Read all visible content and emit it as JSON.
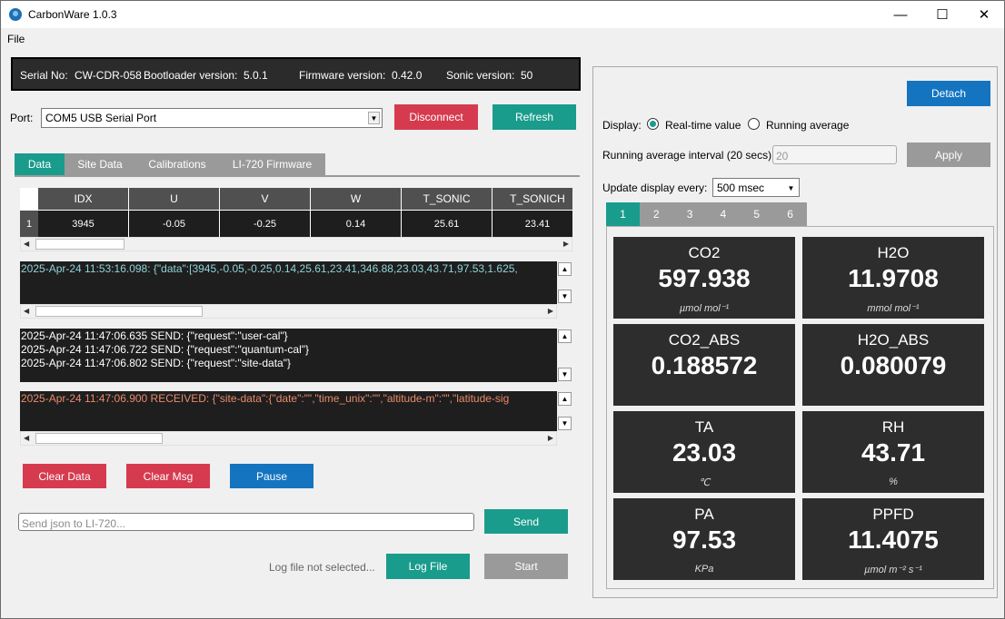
{
  "window": {
    "title": "CarbonWare 1.0.3",
    "minimize": "—",
    "maximize": "☐",
    "close": "✕"
  },
  "menu": {
    "file": "File"
  },
  "info": {
    "serial_label": "Serial No:",
    "serial_value": "CW-CDR-058",
    "bootloader_label": "Bootloader version:",
    "bootloader_value": "5.0.1",
    "firmware_label": "Firmware version:",
    "firmware_value": "0.42.0",
    "sonic_label": "Sonic version:",
    "sonic_value": "50"
  },
  "port": {
    "label": "Port:",
    "value": "COM5 USB Serial Port",
    "disconnect": "Disconnect",
    "refresh": "Refresh"
  },
  "tabs_left": [
    "Data",
    "Site Data",
    "Calibrations",
    "LI-720 Firmware"
  ],
  "grid": {
    "columns": [
      "IDX",
      "U",
      "V",
      "W",
      "T_SONIC",
      "T_SONICH"
    ],
    "row_number": "1",
    "row": [
      "3945",
      "-0.05",
      "-0.25",
      "0.14",
      "25.61",
      "23.41"
    ]
  },
  "console_data": [
    "2025-Apr-24 11:53:16.098: {\"data\":[3945,-0.05,-0.25,0.14,25.61,23.41,346.88,23.03,43.71,97.53,1.625,"
  ],
  "console_send": [
    "2025-Apr-24 11:47:06.635 SEND: {\"request\":\"user-cal\"}",
    "2025-Apr-24 11:47:06.722 SEND: {\"request\":\"quantum-cal\"}",
    "2025-Apr-24 11:47:06.802 SEND: {\"request\":\"site-data\"}"
  ],
  "console_recv": [
    "2025-Apr-24 11:47:06.900 RECEIVED: {\"site-data\":{\"date\":\"\",\"time_unix\":\"\",\"altitude-m\":\"\",\"latitude-sig"
  ],
  "buttons": {
    "clear_data": "Clear Data",
    "clear_msg": "Clear Msg",
    "pause": "Pause",
    "send": "Send",
    "log_file": "Log File",
    "start": "Start",
    "detach": "Detach",
    "apply": "Apply"
  },
  "send_input": {
    "placeholder": "Send json to LI-720..."
  },
  "log_status": "Log file not selected...",
  "display": {
    "label": "Display:",
    "realtime": "Real-time value",
    "running": "Running average",
    "interval_label": "Running average interval (20 secs):",
    "interval_value": "20",
    "update_label": "Update display every:",
    "update_value": "500 msec"
  },
  "tabs_right": [
    "1",
    "2",
    "3",
    "4",
    "5",
    "6"
  ],
  "cards": [
    {
      "name": "CO2",
      "value": "597.938",
      "unit": "µmol mol⁻¹"
    },
    {
      "name": "H2O",
      "value": "11.9708",
      "unit": "mmol mol⁻¹"
    },
    {
      "name": "CO2_ABS",
      "value": "0.188572",
      "unit": ""
    },
    {
      "name": "H2O_ABS",
      "value": "0.080079",
      "unit": ""
    },
    {
      "name": "TA",
      "value": "23.03",
      "unit": "℃"
    },
    {
      "name": "RH",
      "value": "43.71",
      "unit": "%"
    },
    {
      "name": "PA",
      "value": "97.53",
      "unit": "KPa"
    },
    {
      "name": "PPFD",
      "value": "11.4075",
      "unit": "µmol m⁻² s⁻¹"
    }
  ],
  "colors": {
    "accent": "#1a9c8c",
    "danger": "#d63a4f",
    "primary": "#1474c0",
    "card_bg": "#2d2d2d",
    "console_data_text": "#8fd3d8",
    "console_send_text": "#ffffff",
    "console_recv_text": "#e88a6a"
  }
}
